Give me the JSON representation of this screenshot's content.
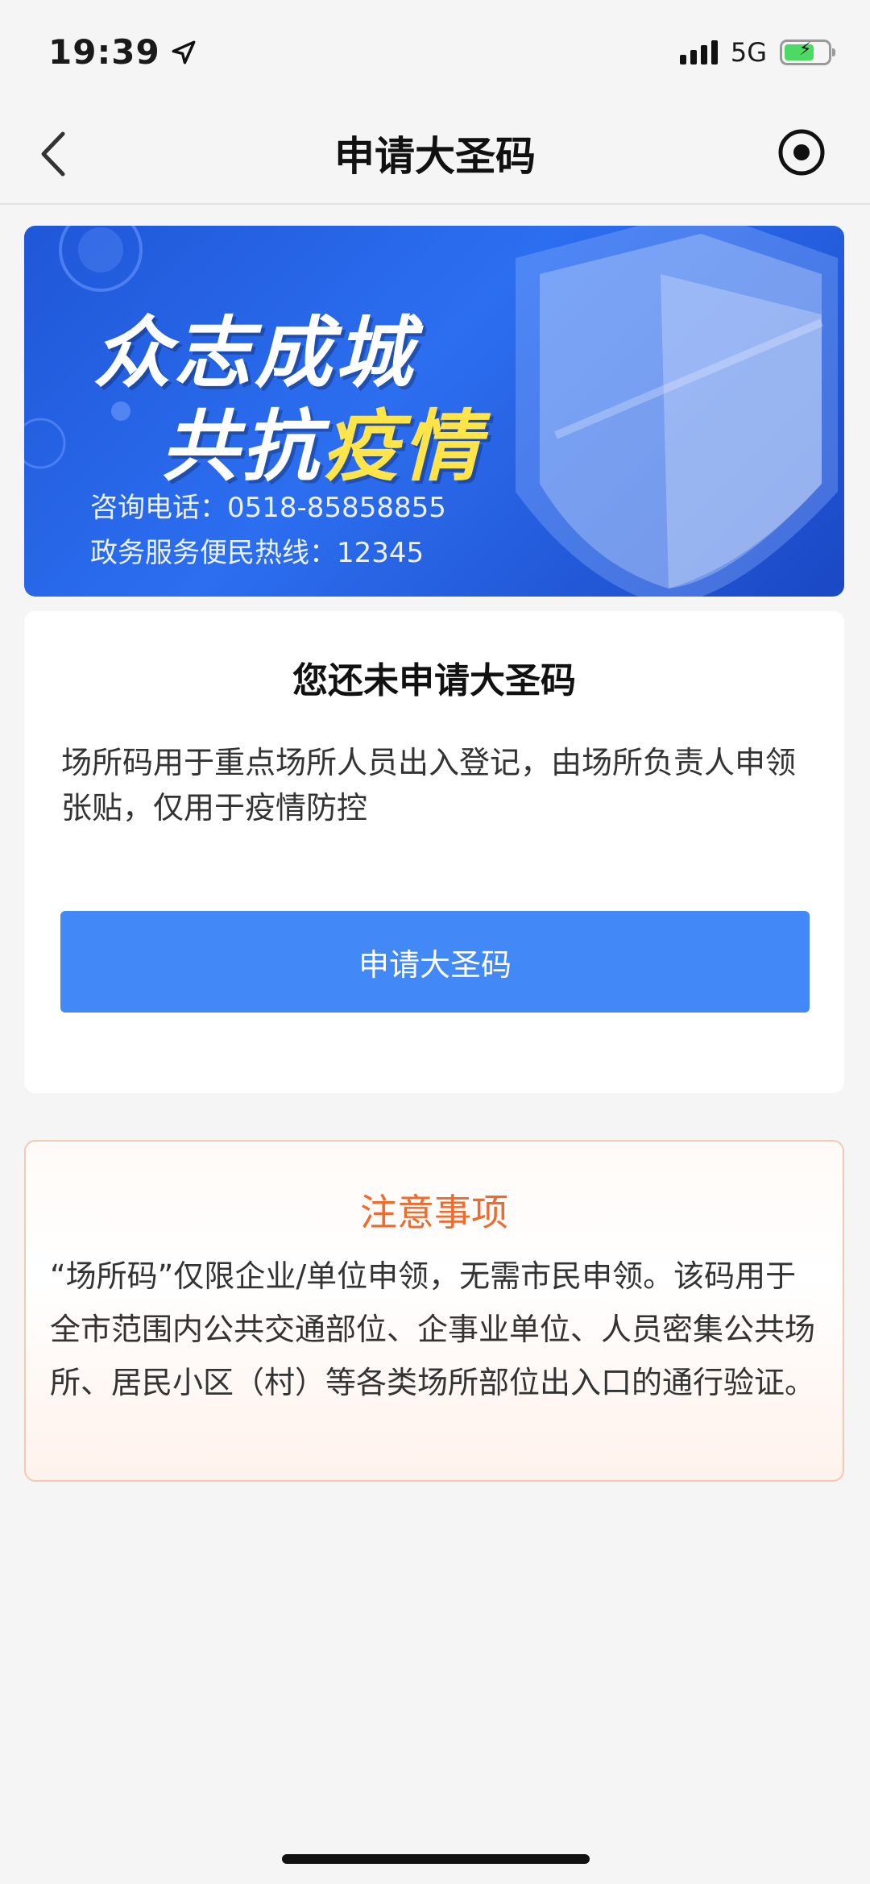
{
  "status_bar": {
    "time": "19:39",
    "network": "5G",
    "icons": [
      "location-arrow-icon",
      "signal-icon",
      "battery-charging-icon"
    ],
    "battery_color": "#4cd964"
  },
  "nav": {
    "title": "申请大圣码",
    "back_icon": "chevron-left-icon",
    "right_icon": "target-icon"
  },
  "banner": {
    "line1": "众志成城",
    "line2_prefix": "共抗",
    "line2_highlight": "疫情",
    "phone": "咨询电话：0518-85858855",
    "hotline": "政务服务便民热线：12345",
    "highlight_color": "#ffe44a",
    "background_color": "#1f57d8"
  },
  "card": {
    "title": "您还未申请大圣码",
    "description": "场所码用于重点场所人员出入登记，由场所负责人申领张贴，仅用于疫情防控",
    "button_label": "申请大圣码",
    "button_color": "#4289f7"
  },
  "notice": {
    "title": "注意事项",
    "body": "“场所码”仅限企业/单位申领，无需市民申领。该码用于全市范围内公共交通部位、企事业单位、人员密集公共场所、居民小区（村）等各类场所部位出入口的通行验证。",
    "title_color": "#ef6a2c"
  }
}
